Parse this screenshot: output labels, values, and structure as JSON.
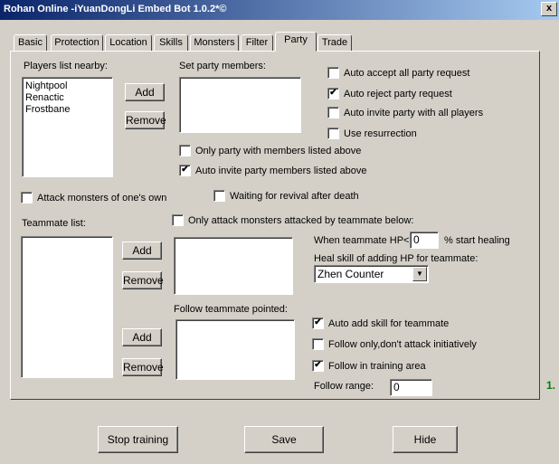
{
  "window": {
    "title": "Rohan Online -iYuanDongLi Embed Bot 1.0.2*©",
    "close": "x"
  },
  "tabs": [
    "Basic",
    "Protection",
    "Location",
    "Skills",
    "Monsters",
    "Filter",
    "Party",
    "Trade"
  ],
  "active_tab": "Party",
  "players": {
    "label": "Players list nearby:",
    "items": [
      "Nightpool",
      "Renactic",
      "Frostbane"
    ],
    "add": "Add",
    "remove": "Remove"
  },
  "party": {
    "label": "Set party members:",
    "only_party_listed": "Only party with members listed above",
    "auto_invite_listed": "Auto invite party members listed above",
    "auto_accept": "Auto accept all party request",
    "auto_reject": "Auto reject party request",
    "auto_invite_all": "Auto invite party with all players",
    "use_resurrection": "Use resurrection",
    "checked": {
      "only_party_listed": false,
      "auto_invite_listed": true,
      "auto_accept": false,
      "auto_reject": true,
      "auto_invite_all": false,
      "use_resurrection": false
    }
  },
  "misc": {
    "attack_own": "Attack monsters of one's own",
    "wait_revival": "Waiting for revival after death",
    "only_attack_teammate": "Only attack monsters attacked by teammate below:",
    "checked": {
      "attack_own": false,
      "wait_revival": false,
      "only_attack_teammate": false
    }
  },
  "teammate": {
    "label": "Teammate list:",
    "add": "Add",
    "remove": "Remove",
    "follow_label": "Follow teammate pointed:",
    "follow_add": "Add",
    "follow_remove": "Remove"
  },
  "healing": {
    "hp_label": "When teammate HP<",
    "hp_value": "0",
    "hp_suffix": "% start healing",
    "skill_label": "Heal skill of adding HP for teammate:",
    "skill_value": "Zhen Counter"
  },
  "follow": {
    "auto_add_skill": "Auto add skill for teammate",
    "follow_only": "Follow only,don't attack initiatively",
    "follow_training": "Follow in training area",
    "range_label": "Follow range:",
    "range_value": "0",
    "checked": {
      "auto_add_skill": true,
      "follow_only": false,
      "follow_training": true
    }
  },
  "version_text": "1.",
  "footer": {
    "stop": "Stop training",
    "save": "Save",
    "hide": "Hide"
  },
  "check_glyph": "✔"
}
